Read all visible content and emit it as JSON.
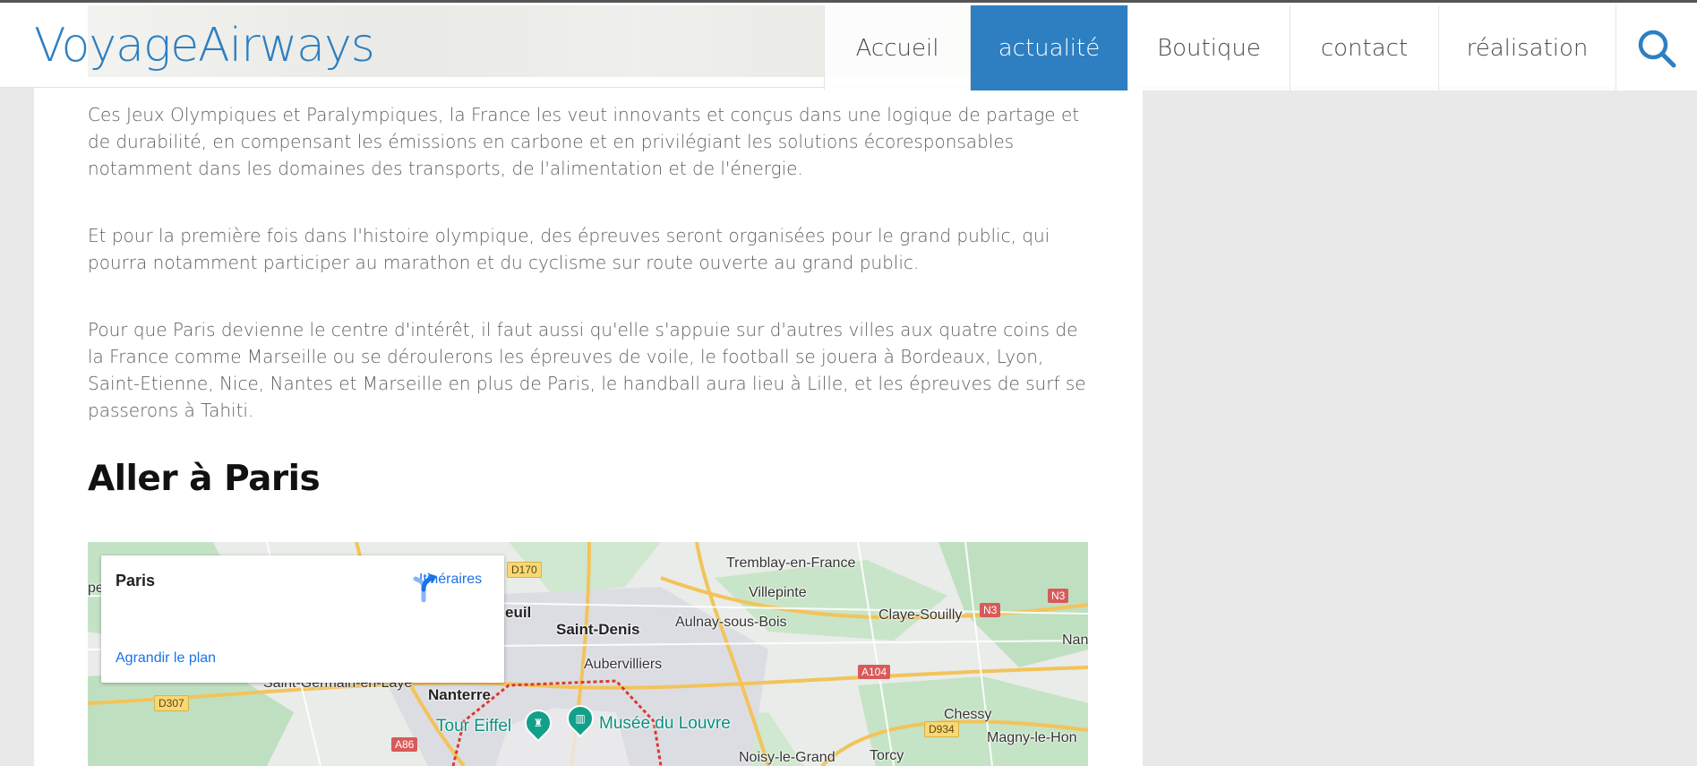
{
  "header": {
    "logo": "VoyageAirways",
    "nav": [
      {
        "label": "Accueil",
        "active": false
      },
      {
        "label": "actualité",
        "active": true
      },
      {
        "label": "Boutique",
        "active": false
      },
      {
        "label": "contact",
        "active": false
      },
      {
        "label": "réalisation",
        "active": false
      }
    ],
    "search_icon": "search-icon",
    "accent_color": "#2d7fc1"
  },
  "article": {
    "paragraphs": [
      "Ces Jeux Olympiques et Paralympiques, la France les veut innovants et conçus dans une logique de partage et de durabilité, en compensant les émissions en carbone et en privilégiant les solutions écoresponsables notamment dans les domaines des transports, de l'alimentation et de l'énergie.",
      "Et pour la première fois dans l'histoire olympique, des épreuves seront organisées pour le grand public, qui pourra notamment participer au marathon et du cyclisme sur route ouverte au grand public.",
      "Pour que Paris devienne le centre d'intérêt, il faut aussi qu'elle s'appuie sur d'autres villes aux quatre coins de la France comme Marseille ou se déroulerons les épreuves de voile, le football se jouera à Bordeaux, Lyon, Saint-Etienne, Nice, Nantes et Marseille en plus de Paris, le handball aura lieu à Lille, et les épreuves de surf se passerons à Tahiti."
    ],
    "heading": "Aller à Paris"
  },
  "map": {
    "card": {
      "place": "Paris",
      "directions_label": "Itinéraires",
      "enlarge_label": "Agrandir le plan"
    },
    "labels": {
      "tremblay": "Tremblay-en-France",
      "villepinte": "Villepinte",
      "claye": "Claye-Souilly",
      "saint_denis": "Saint-Denis",
      "aulnay": "Aulnay-sous-Bois",
      "aubervilliers": "Aubervilliers",
      "saint_germain": "Saint-Germain-en-Laye",
      "nanterre": "Nanterre",
      "tour_eiffel": "Tour Eiffel",
      "louvre": "Musée du Louvre",
      "chessy": "Chessy",
      "magny": "Magny-le-Hon",
      "noisy": "Noisy-le-Grand",
      "torcy": "Torcy",
      "nan": "Nan",
      "euil": "euil",
      "pe": "pe"
    },
    "shields": {
      "d170": "D170",
      "n3a": "N3",
      "n3b": "N3",
      "a104": "A104",
      "d307": "D307",
      "a86": "A86",
      "d934": "D934"
    }
  }
}
